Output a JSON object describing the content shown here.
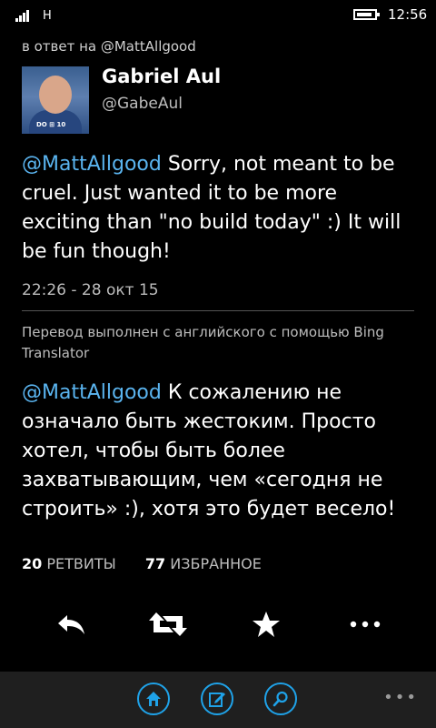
{
  "status": {
    "network": "H",
    "time": "12:56"
  },
  "reply_to": "в ответ на @MattAllgood",
  "author": {
    "name": "Gabriel Aul",
    "handle": "@GabeAul",
    "avatar_badge": "DO ⊞ 10"
  },
  "tweet": {
    "mention": "@MattAllgood",
    "text": " Sorry, not meant to be cruel. Just wanted it to be more exciting than \"no build today\" :) It will be fun though!",
    "timestamp": "22:26 - 28 окт 15"
  },
  "translation": {
    "note": "Перевод выполнен с английского с помощью Bing Translator",
    "mention": "@MattAllgood",
    "text": " К сожалению не означало быть жестоким. Просто хотел, чтобы быть более захватывающим, чем «сегодня не строить» :), хотя это будет весело!"
  },
  "stats": {
    "retweets_count": "20",
    "retweets_label": "РЕТВИТЫ",
    "favorites_count": "77",
    "favorites_label": "ИЗБРАННОЕ"
  },
  "actions": [
    "reply-icon",
    "retweet-icon",
    "favorite-star-icon",
    "more-dots-icon"
  ],
  "appbar": {
    "buttons": [
      "home-icon",
      "compose-icon",
      "search-icon"
    ],
    "more": "•••"
  },
  "colors": {
    "accent": "#1fa2e8",
    "mention": "#5ab4ef",
    "background": "#000000"
  }
}
